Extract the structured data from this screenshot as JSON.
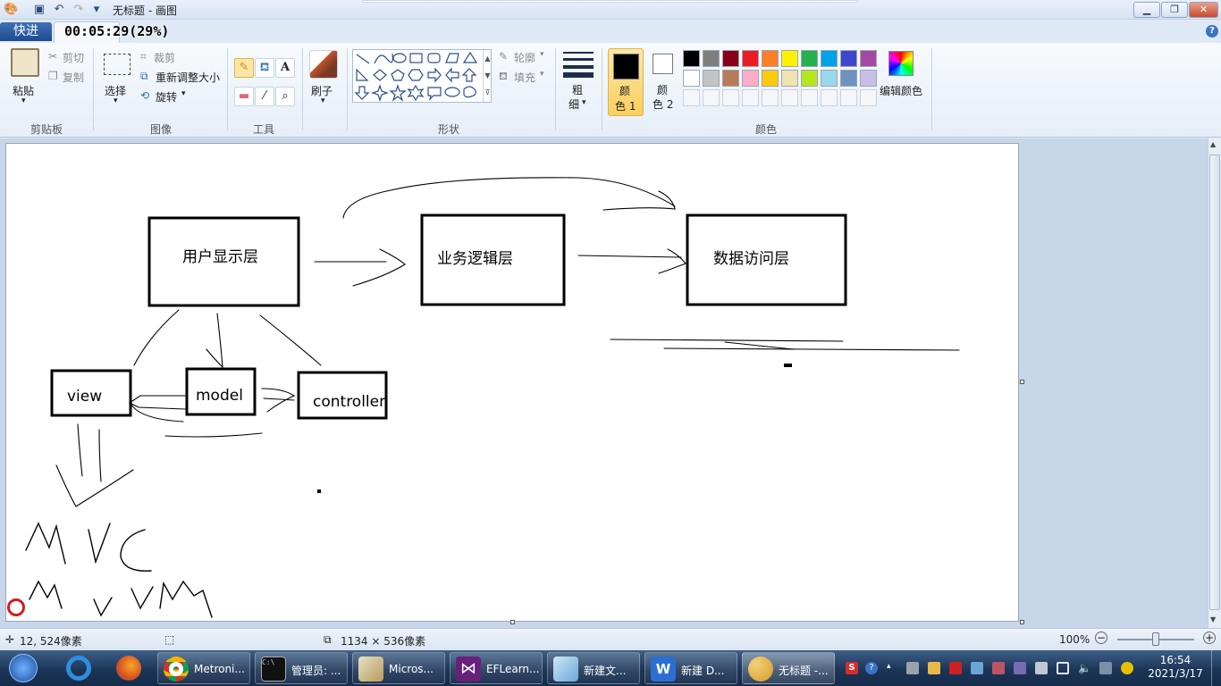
{
  "window": {
    "title": "无标题 - 画图",
    "recording_label": "快进",
    "recording_time": "00:05:29(29%)"
  },
  "ribbon": {
    "clipboard": {
      "paste": "粘贴",
      "cut": "剪切",
      "copy": "复制",
      "group": "剪贴板"
    },
    "image": {
      "select": "选择",
      "crop": "裁剪",
      "resize": "重新调整大小",
      "rotate": "旋转",
      "group": "图像"
    },
    "tools": {
      "group": "工具"
    },
    "brushes": {
      "label": "刷子"
    },
    "shapes": {
      "outline": "轮廓",
      "fill": "填充",
      "group": "形状"
    },
    "size": {
      "label_top": "粗",
      "label_bottom": "细"
    },
    "colors": {
      "color1_top": "颜",
      "color1_bottom": "色 1",
      "color2_top": "颜",
      "color2_bottom": "色 2",
      "edit": "编辑颜色",
      "group": "颜色",
      "palette_row1": [
        "#000000",
        "#7f7f7f",
        "#880015",
        "#ed1c24",
        "#ff7f27",
        "#fff200",
        "#22b14c",
        "#00a2e8",
        "#3f48cc",
        "#a349a4"
      ],
      "palette_row2": [
        "#ffffff",
        "#c3c3c3",
        "#b97a57",
        "#ffaec9",
        "#ffc90e",
        "#efe4b0",
        "#b5e61d",
        "#99d9ea",
        "#7092be",
        "#c8bfe7"
      ],
      "color1_value": "#000000",
      "color2_value": "#ffffff"
    }
  },
  "drawing": {
    "box_ui": "用户显示层",
    "box_biz": "业务逻辑层",
    "box_data": "数据访问层",
    "box_view": "view",
    "box_model": "model",
    "box_controller": "controller"
  },
  "status": {
    "cursor_pos": "12, 524像素",
    "canvas_size": "1134 × 536像素",
    "zoom": "100%"
  },
  "taskbar": {
    "items": [
      "Metroni...",
      "管理员: ...",
      "Micros...",
      "EFLearn...",
      "新建文...",
      "新建 D...",
      "无标题 -..."
    ],
    "time": "16:54",
    "date": "2021/3/17"
  }
}
